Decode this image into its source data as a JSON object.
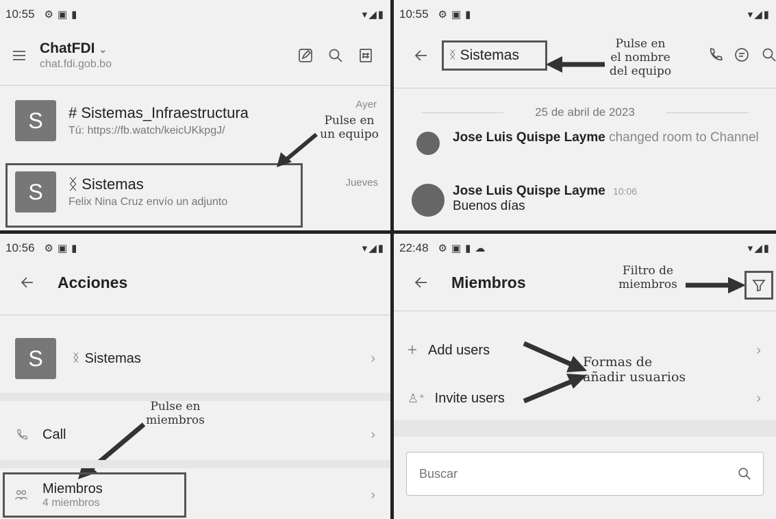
{
  "panel1": {
    "status_time": "10:55",
    "app_title": "ChatFDI",
    "app_subtitle": "chat.fdi.gob.bo",
    "rooms": [
      {
        "avatar": "S",
        "name": "# Sistemas_Infraestructura",
        "last": "Tú: https://fb.watch/keicUKkpgJ/",
        "time": "Ayer"
      },
      {
        "avatar": "S",
        "name": "ᛝ Sistemas",
        "last": "Felix Nina Cruz envío un adjunto",
        "time": "Jueves"
      }
    ],
    "annotation": "Pulse en\nun equipo"
  },
  "panel2": {
    "status_time": "10:55",
    "team_name": "Sistemas",
    "annotation": "Pulse en\nel nombre\ndel equipo",
    "date_separator": "25 de abril de 2023",
    "messages": [
      {
        "author": "Jose Luis Quispe Layme",
        "text": "changed room to Channel",
        "stamp": ""
      },
      {
        "author": "Jose Luis Quispe Layme",
        "text": "Buenos días",
        "stamp": "10:06"
      }
    ]
  },
  "panel3": {
    "status_time": "10:56",
    "title": "Acciones",
    "team": {
      "avatar": "S",
      "name": "Sistemas"
    },
    "call_label": "Call",
    "members_label": "Miembros",
    "members_count": "4 miembros",
    "annotation": "Pulse en\nmiembros"
  },
  "panel4": {
    "status_time": "22:48",
    "title": "Miembros",
    "filter_annotation": "Filtro de\nmiembros",
    "add_users": "Add users",
    "invite_users": "Invite users",
    "users_annotation": "Formas de\nañadir usuarios",
    "search_placeholder": "Buscar"
  },
  "colors": {
    "accent": "#555555",
    "background": "#f1f1f1"
  },
  "icons": [
    "menu-icon",
    "edit-icon",
    "search-icon",
    "channel-icon",
    "back-icon",
    "team-icon",
    "phone-icon",
    "threads-icon",
    "filter-icon",
    "plus-icon",
    "invite-user-icon",
    "members-icon",
    "chevron-right-icon"
  ]
}
